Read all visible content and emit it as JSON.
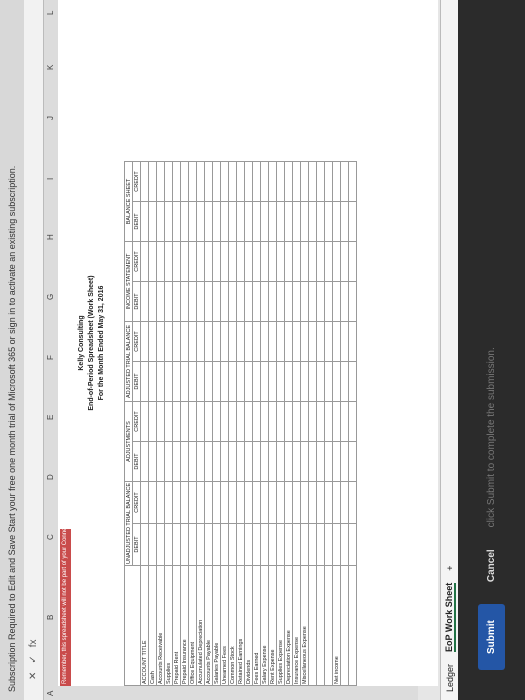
{
  "banner": "Subscription Required to Edit and Save   Start your free one month trial of Microsoft 365 or sign in to activate an existing subscription.",
  "formula_bar": {
    "fx_label": "fx"
  },
  "columns": [
    "A",
    "B",
    "C",
    "D",
    "E",
    "F",
    "G",
    "H",
    "I",
    "J",
    "K",
    "L"
  ],
  "reminder": "Remember, this spreadsheet will not be part of your Connect grade.",
  "header": {
    "company": "Kelly Consulting",
    "title": "End-of-Period Spreadsheet (Work Sheet)",
    "period": "For the Month Ended May 31, 2016"
  },
  "table": {
    "account_title": "ACCOUNT TITLE",
    "groups": [
      "UNADJUSTED TRIAL BALANCE",
      "ADJUSTMENTS",
      "ADJUSTED TRIAL BALANCE",
      "INCOME STATEMENT",
      "BALANCE SHEET"
    ],
    "debit": "DEBIT",
    "credit": "CREDIT",
    "accounts": [
      "Cash",
      "Accounts Receivable",
      "Supplies",
      "Prepaid Rent",
      "Prepaid Insurance",
      "Office Equipment",
      "Accumulated Depreciation",
      "Accounts Payable",
      "Salaries Payable",
      "Unearned Fees",
      "Common Stock",
      "Retained Earnings",
      "Dividends",
      "Fees Earned",
      "Salary Expense",
      "Rent Expense",
      "Supplies Expense",
      "Depreciation Expense",
      "Insurance Expense",
      "Miscellaneous Expense"
    ],
    "net_income": "Net income"
  },
  "tabs": {
    "ledger": "Ledger",
    "worksheet": "EoP Work Sheet",
    "add": "+"
  },
  "footer": {
    "submit": "Submit",
    "cancel": "Cancel",
    "hint": "click Submit to complete the submission."
  }
}
